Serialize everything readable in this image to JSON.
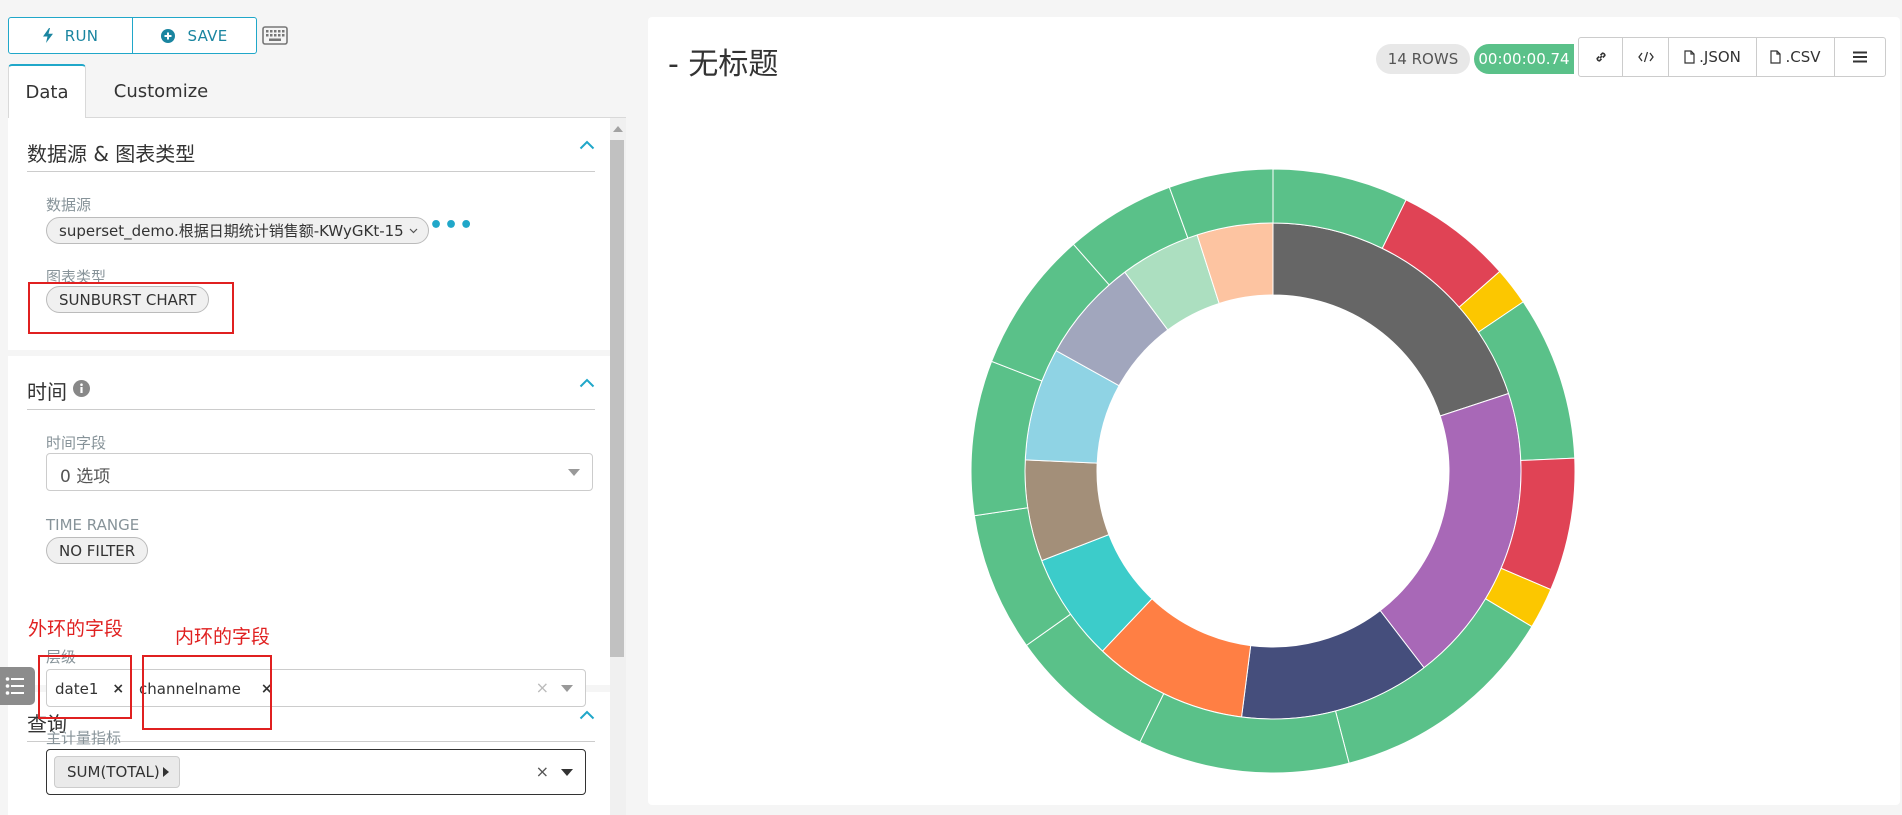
{
  "toolbar": {
    "run_label": "RUN",
    "save_label": "SAVE"
  },
  "tabs": [
    {
      "label": "Data"
    },
    {
      "label": "Customize"
    }
  ],
  "sections": {
    "datasource": {
      "title": "数据源 & 图表类型",
      "datasource_label": "数据源",
      "datasource_value": "superset_demo.根据日期统计销售额-KWyGKt-15",
      "chart_type_label": "图表类型",
      "chart_type_value": "SUNBURST CHART"
    },
    "time": {
      "title": "时间",
      "time_field_label": "时间字段",
      "time_field_placeholder": "0 选项",
      "time_range_label": "TIME RANGE",
      "time_range_value": "NO FILTER"
    },
    "query": {
      "title": "查询",
      "hierarchy_label": "层级",
      "hierarchy_tags": [
        "date1",
        "channelname"
      ],
      "metric_label": "主计量指标",
      "metric_value": "SUM(TOTAL)"
    }
  },
  "annotations": {
    "outer_ring_note": "外环的字段",
    "inner_ring_note": "内环的字段"
  },
  "chart_header": {
    "title": "- 无标题",
    "rows": "14 ROWS",
    "timer": "00:00:00.74",
    "json_label": ".JSON",
    "csv_label": ".CSV"
  },
  "chart_data": {
    "type": "sunburst",
    "inner_ring": [
      {
        "value": 66.5,
        "color": "#666666"
      },
      {
        "value": 65.5,
        "color": "#a868b7"
      },
      {
        "value": 41.5,
        "color": "#454e7c"
      },
      {
        "value": 33.5,
        "color": "#ff7f44"
      },
      {
        "value": 23.5,
        "color": "#3cccca"
      },
      {
        "value": 22,
        "color": "#a38f79"
      },
      {
        "value": 24.5,
        "color": "#8fd3e4"
      },
      {
        "value": 22.5,
        "color": "#a1a6bd"
      },
      {
        "value": 17.5,
        "color": "#acdfc0"
      },
      {
        "value": 16.5,
        "color": "#fdc4a1"
      }
    ],
    "outer_ring": [
      {
        "value": 21.5,
        "color": "#5ac189"
      },
      {
        "value": 18.5,
        "color": "#e04355"
      },
      {
        "value": 6,
        "color": "#fcc700"
      },
      {
        "value": 26,
        "color": "#5ac189"
      },
      {
        "value": 21,
        "color": "#e04355"
      },
      {
        "value": 6.5,
        "color": "#fcc700"
      },
      {
        "value": 36.5,
        "color": "#5ac189"
      },
      {
        "value": 33.5,
        "color": "#5ac189"
      },
      {
        "value": 23.5,
        "color": "#5ac189"
      },
      {
        "value": 22,
        "color": "#5ac189"
      },
      {
        "value": 24.5,
        "color": "#5ac189"
      },
      {
        "value": 22.5,
        "color": "#5ac189"
      },
      {
        "value": 17.5,
        "color": "#5ac189"
      },
      {
        "value": 16.5,
        "color": "#5ac189"
      }
    ]
  }
}
